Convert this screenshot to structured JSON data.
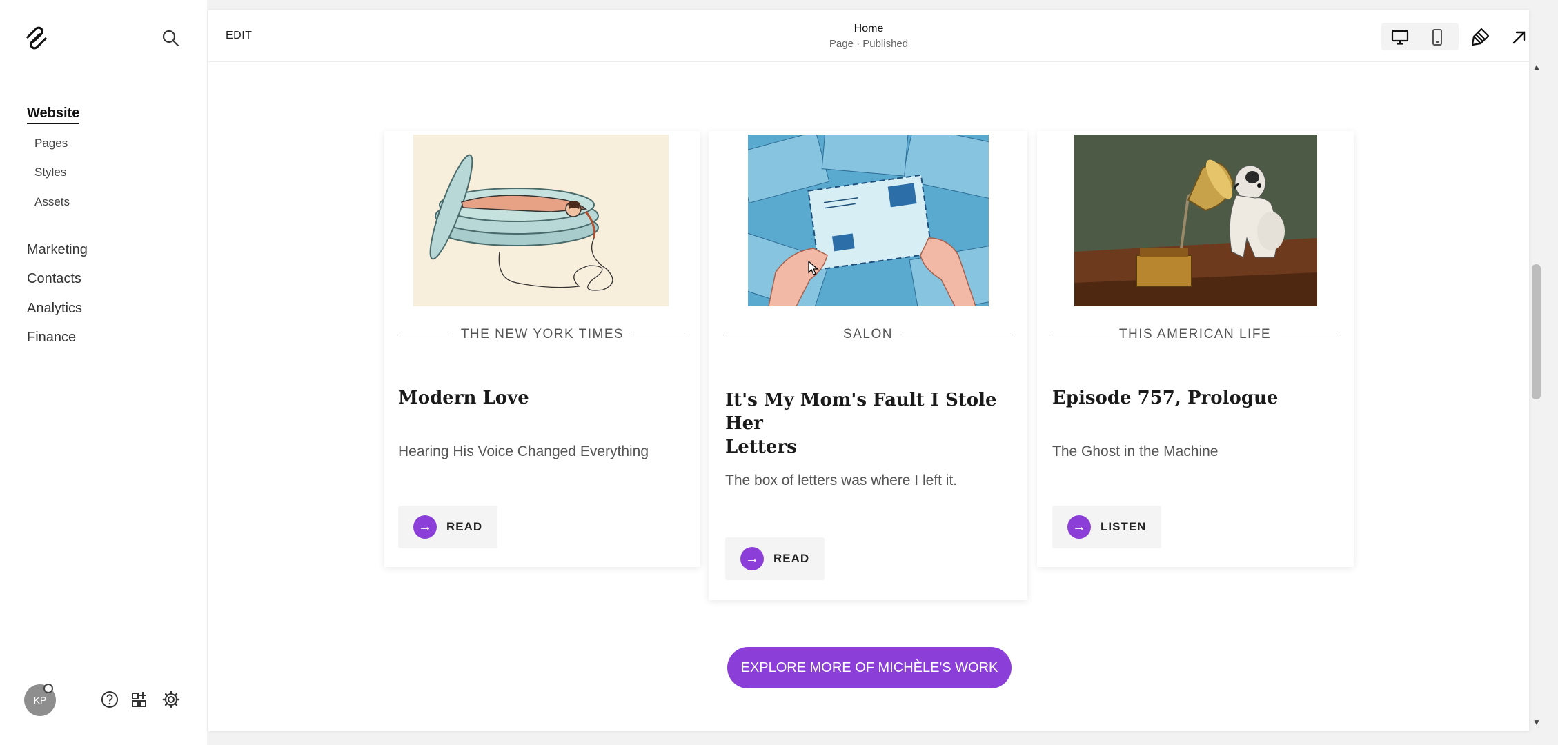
{
  "sidebar": {
    "items": {
      "website": "Website",
      "pages": "Pages",
      "styles": "Styles",
      "assets": "Assets",
      "marketing": "Marketing",
      "contacts": "Contacts",
      "analytics": "Analytics",
      "finance": "Finance"
    },
    "avatar_initials": "KP"
  },
  "topbar": {
    "edit_label": "EDIT",
    "page_title": "Home",
    "page_status": "Page · Published"
  },
  "cards": [
    {
      "source": "THE NEW YORK TIMES",
      "title": "Modern Love",
      "description": "Hearing His Voice Changed Everything",
      "button_label": "READ"
    },
    {
      "source": "SALON",
      "title_line1": "It's My Mom's Fault I Stole Her",
      "title_line2": "Letters",
      "description": "The box of letters was where I left it.",
      "button_label": "READ"
    },
    {
      "source": "THIS AMERICAN LIFE",
      "title": "Episode 757, Prologue",
      "description": "The Ghost in the Machine",
      "button_label": "LISTEN"
    }
  ],
  "cta": {
    "label": "EXPLORE MORE OF MICHÈLE'S WORK"
  },
  "colors": {
    "accent": "#8b3fd8"
  },
  "icons": [
    "squarespace-logo-icon",
    "search-icon",
    "help-icon",
    "apps-icon",
    "gear-icon",
    "desktop-icon",
    "mobile-icon",
    "design-brush-icon",
    "external-arrow-icon"
  ]
}
